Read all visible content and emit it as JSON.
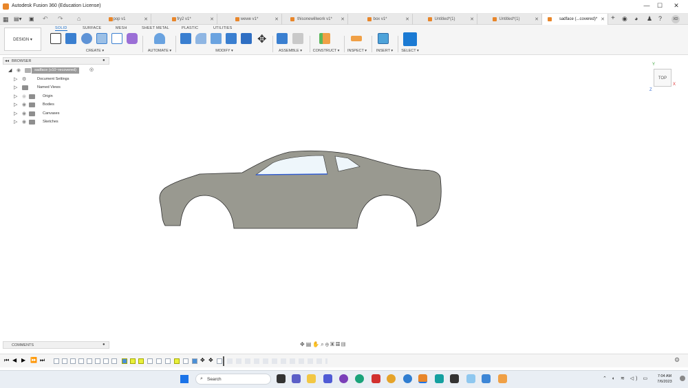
{
  "window": {
    "title": "Autodesk Fusion 360 (Education License)",
    "controls": {
      "minimize": "—",
      "maximize": "☐",
      "close": "✕"
    }
  },
  "tabs": [
    {
      "label": "pop v1",
      "active": false
    },
    {
      "label": "fry2 v1*",
      "active": false
    },
    {
      "label": "wewe v1*",
      "active": false
    },
    {
      "label": "thisonewillwork v1*",
      "active": false
    },
    {
      "label": "box v1*",
      "active": false
    },
    {
      "label": "Untitled*(1)",
      "active": false
    },
    {
      "label": "Untitled*(1)",
      "active": false
    },
    {
      "label": "sadface (...covered)*",
      "active": true
    }
  ],
  "toolbar": {
    "workspace": "DESIGN ▾",
    "categories": [
      "SOLID",
      "SURFACE",
      "MESH",
      "SHEET METAL",
      "PLASTIC",
      "UTILITIES"
    ],
    "groups": [
      "CREATE ▾",
      "AUTOMATE ▾",
      "MODIFY ▾",
      "ASSEMBLE ▾",
      "CONSTRUCT ▾",
      "INSPECT ▾",
      "INSERT ▾",
      "SELECT ▾"
    ]
  },
  "browser": {
    "title": "BROWSER",
    "root": "sadface (v10~recovered)",
    "items": [
      "Document Settings",
      "Named Views",
      "Origin",
      "Bodies",
      "Canvases",
      "Sketches"
    ]
  },
  "viewcube": {
    "face": "TOP",
    "axis_x": "X",
    "axis_y": "Y",
    "axis_z": "Z"
  },
  "comments": {
    "title": "COMMENTS"
  },
  "taskbar": {
    "search_placeholder": "Search",
    "time": "7:04 AM",
    "date": "7/6/2023"
  },
  "colors": {
    "accent": "#1b6fc9",
    "body_fill": "#999990",
    "window_fill": "#eef6fb",
    "sketch_line": "#2f5bd3",
    "timeline_highlight": "#e9f03a"
  }
}
